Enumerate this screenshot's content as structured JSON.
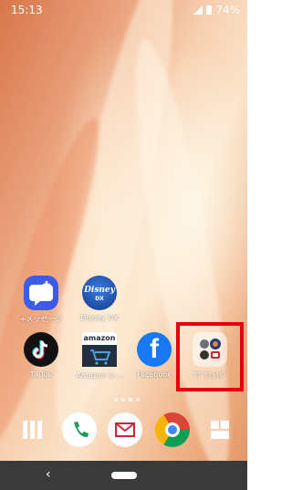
{
  "status_bar": {
    "time": "15:13",
    "battery": "74%"
  },
  "apps": [
    {
      "label": "+メッセージ",
      "icon": "message-plus-icon"
    },
    {
      "label": "Disney DX",
      "icon": "disney-icon"
    },
    {
      "label": "TikTok",
      "icon": "tiktok-icon"
    },
    {
      "label": "Amazon シ…",
      "icon": "amazon-icon",
      "brand_text": "amazon"
    },
    {
      "label": "Facebook",
      "icon": "facebook-icon",
      "brand_text": "f"
    },
    {
      "label": "ｱﾌﾟﾘﾌｫﾙﾀﾞ",
      "icon": "app-folder-icon"
    }
  ],
  "disney_logo_text": "Disney",
  "disney_logo_sub": "DX",
  "dock": [
    {
      "icon": "app-drawer-icon"
    },
    {
      "icon": "phone-icon"
    },
    {
      "icon": "mail-icon"
    },
    {
      "icon": "chrome-icon"
    },
    {
      "icon": "widgets-icon"
    }
  ],
  "nav": {
    "back": "‹"
  },
  "colors": {
    "highlight": "#e3000f",
    "facebook": "#1877f2",
    "amazon": "#232f3e"
  }
}
